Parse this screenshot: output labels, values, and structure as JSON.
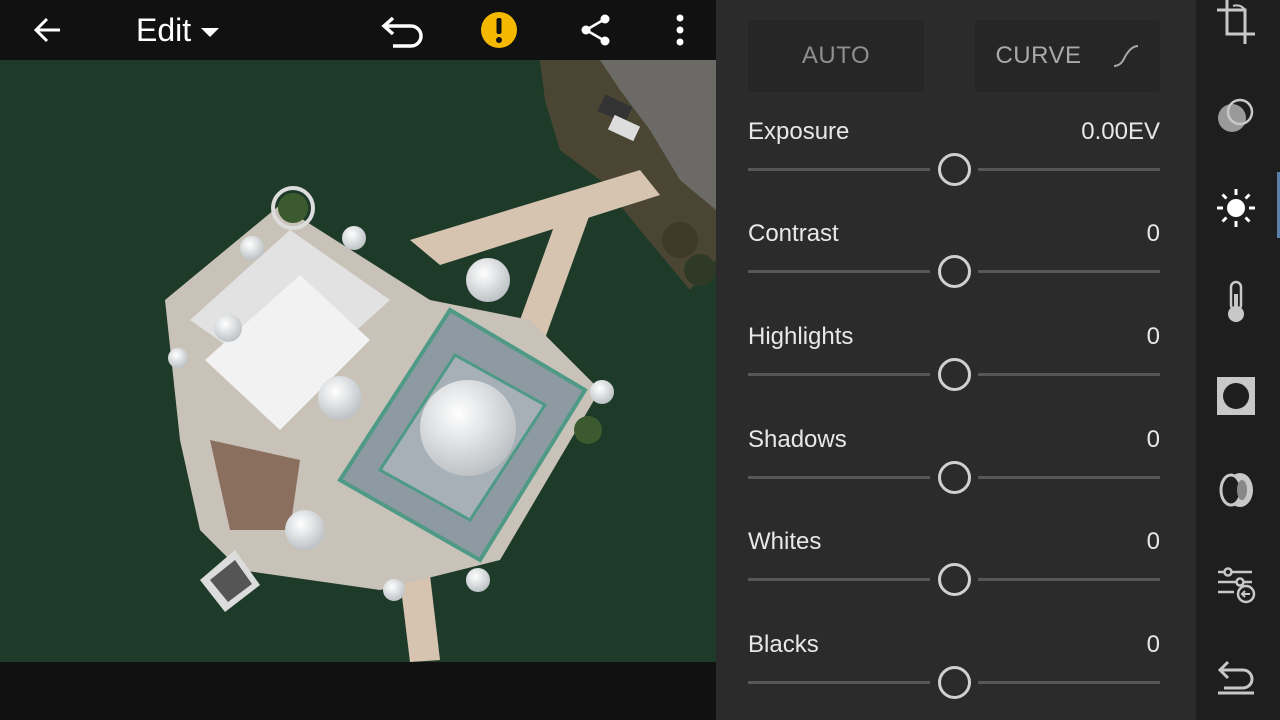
{
  "header": {
    "edit_label": "Edit"
  },
  "panel": {
    "auto_label": "AUTO",
    "curve_label": "CURVE",
    "sliders": [
      {
        "label": "Exposure",
        "value": "0.00EV",
        "level": 0.5
      },
      {
        "label": "Contrast",
        "value": "0",
        "level": 0.5
      },
      {
        "label": "Highlights",
        "value": "0",
        "level": 0.5
      },
      {
        "label": "Shadows",
        "value": "0",
        "level": 0.5
      },
      {
        "label": "Whites",
        "value": "0",
        "level": 0.5
      },
      {
        "label": "Blacks",
        "value": "0",
        "level": 0.5
      }
    ]
  },
  "rail": {
    "tools": [
      "crop-icon",
      "selective-icon",
      "light-icon",
      "color-temperature-icon",
      "vignette-icon",
      "optics-icon",
      "detail-adjust-icon",
      "reset-icon"
    ],
    "active_tool": "light-icon"
  },
  "colors": {
    "warning": "#f5b800",
    "water": "#1d3a29",
    "panel_bg": "#2b2b2b",
    "active_indicator": "#5a7fa8"
  }
}
